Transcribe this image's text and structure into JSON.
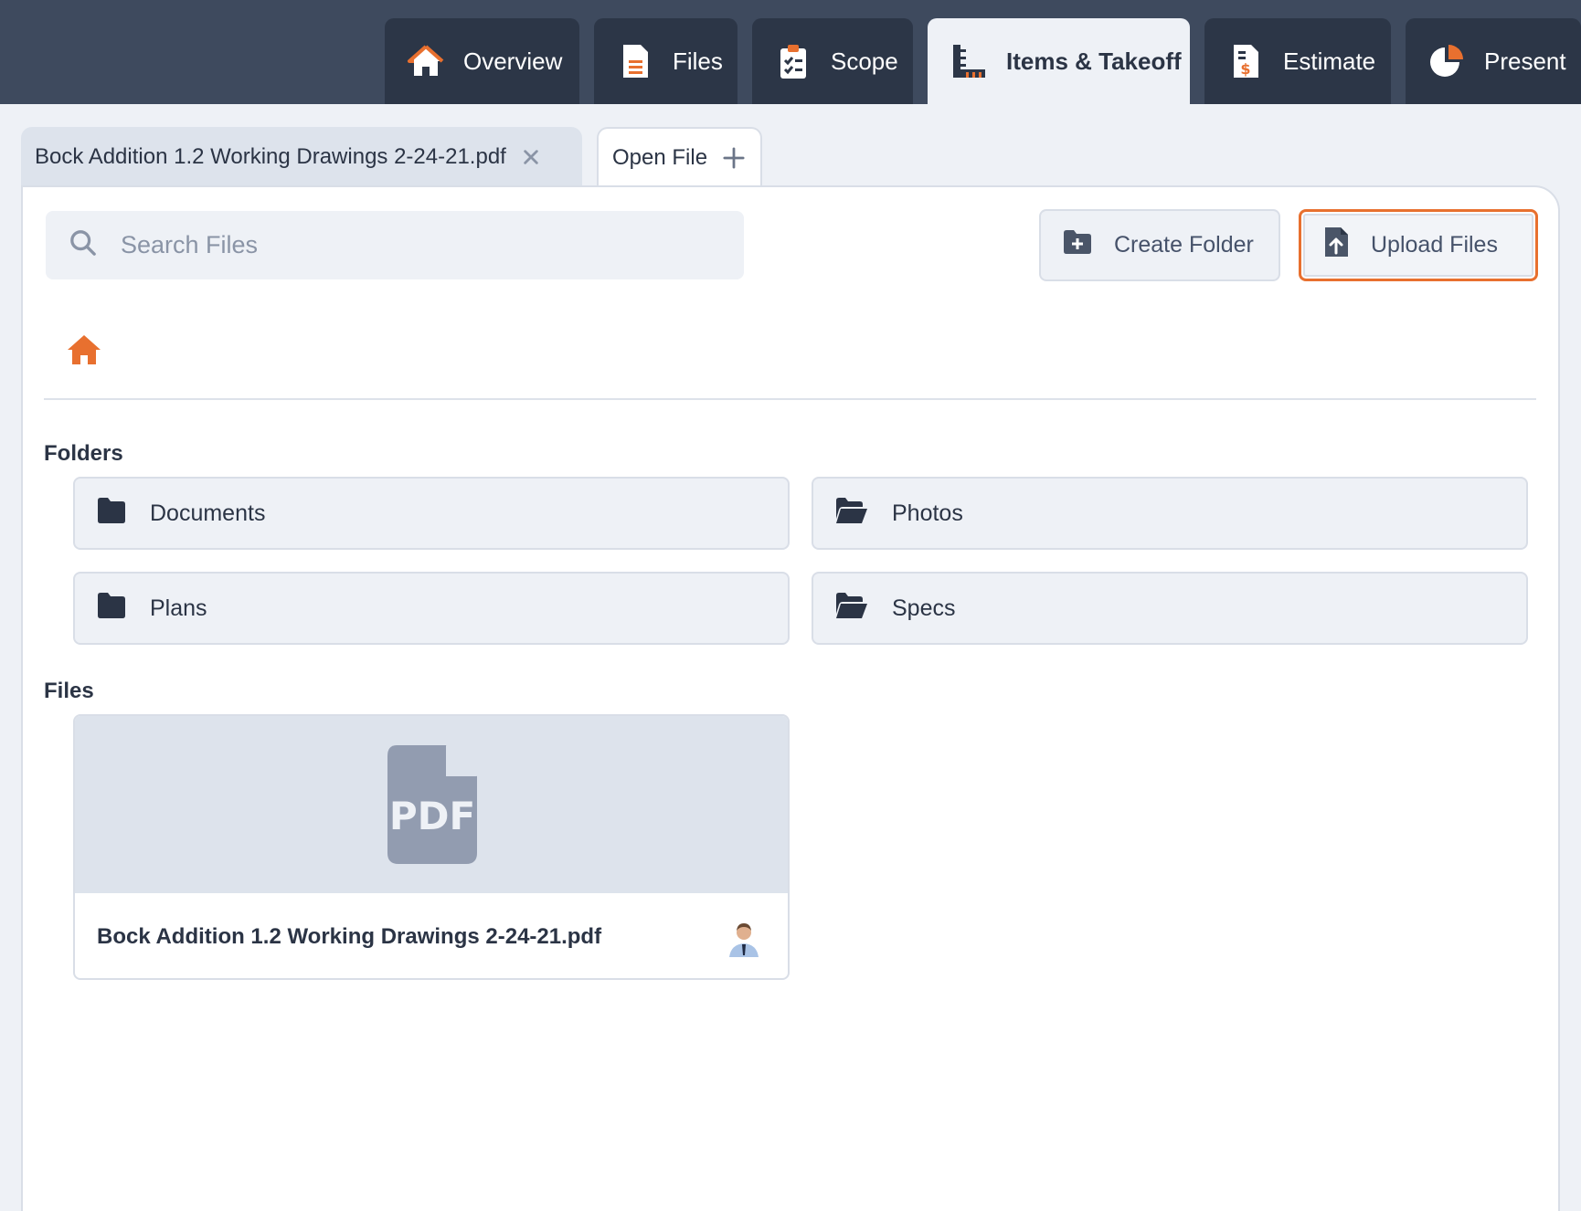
{
  "nav": {
    "tabs": [
      {
        "label": "Overview",
        "icon": "home-icon",
        "active": false
      },
      {
        "label": "Files",
        "icon": "document-icon",
        "active": false
      },
      {
        "label": "Scope",
        "icon": "clipboard-checklist-icon",
        "active": false
      },
      {
        "label": "Items & Takeoff",
        "icon": "ruler-icon",
        "active": true
      },
      {
        "label": "Estimate",
        "icon": "invoice-dollar-icon",
        "active": false
      },
      {
        "label": "Present",
        "icon": "pie-chart-icon",
        "active": false
      }
    ]
  },
  "file_tabs": {
    "open_document": "Bock Addition 1.2 Working Drawings 2-24-21.pdf",
    "open_file_label": "Open File"
  },
  "search": {
    "placeholder": "Search Files",
    "value": ""
  },
  "actions": {
    "create_folder": "Create Folder",
    "upload_files": "Upload Files"
  },
  "sections": {
    "folders_title": "Folders",
    "files_title": "Files"
  },
  "folders": [
    {
      "name": "Documents",
      "icon": "folder-closed-icon"
    },
    {
      "name": "Photos",
      "icon": "folder-open-icon"
    },
    {
      "name": "Plans",
      "icon": "folder-closed-icon"
    },
    {
      "name": "Specs",
      "icon": "folder-open-icon"
    }
  ],
  "files": [
    {
      "name": "Bock Addition 1.2 Working Drawings 2-24-21.pdf",
      "type_label": "PDF",
      "icon": "pdf-file-icon"
    }
  ],
  "colors": {
    "accent": "#e8702f",
    "nav_bg": "#3e4a5e",
    "nav_tab_bg": "#2c3647",
    "page_bg": "#eef1f6"
  }
}
